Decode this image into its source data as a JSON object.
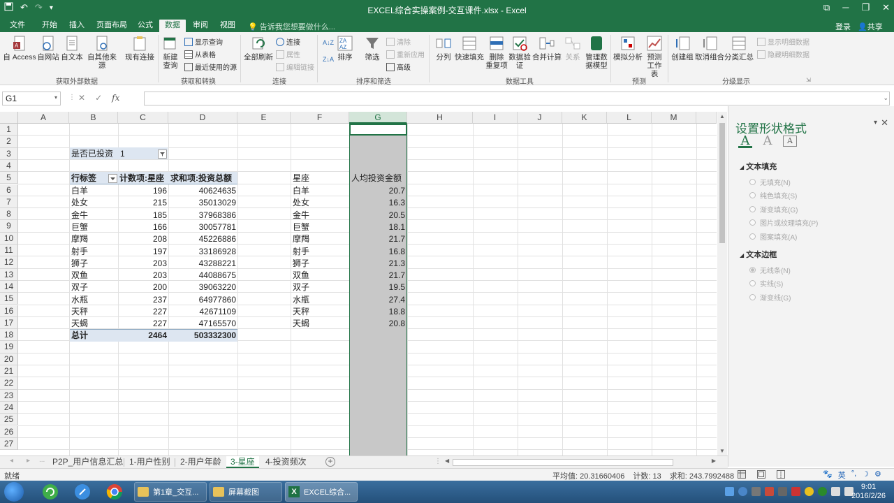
{
  "titlebar": {
    "title": "EXCEL综合实操案例-交互课件.xlsx - Excel",
    "undo": "↶",
    "redo": "↷",
    "qat_more": "▾",
    "win_restore": "⧉",
    "win_min": "─",
    "win_max": "❐",
    "win_close": "✕"
  },
  "tabs": {
    "items": [
      "文件",
      "开始",
      "插入",
      "页面布局",
      "公式",
      "数据",
      "审阅",
      "视图"
    ],
    "active": "数据",
    "tellme": "告诉我您想要做什么...",
    "login": "登录",
    "share": "共享"
  },
  "ribbon": {
    "groups": [
      "获取外部数据",
      "获取和转换",
      "连接",
      "排序和筛选",
      "数据工具",
      "预测",
      "分级显示"
    ],
    "get_external": [
      "自 Access",
      "自网站",
      "自文本",
      "自其他来源",
      "现有连接"
    ],
    "transform": {
      "new_query": "新建",
      "new_query2": "查询",
      "show_queries": "显示查询",
      "from_table": "从表格",
      "recent_sources": "最近使用的源"
    },
    "connections": {
      "refresh_all": "全部刷新",
      "connections": "连接",
      "properties": "属性",
      "edit_links": "编辑链接"
    },
    "sort_filter": {
      "sort": "排序",
      "filter": "筛选",
      "clear": "清除",
      "reapply": "重新应用",
      "advanced": "高级"
    },
    "data_tools": {
      "text_to_columns": "分列",
      "flash_fill": "快速填充",
      "remove_dup": "删除",
      "remove_dup2": "重复项",
      "validation": "数据验",
      "validation2": "证",
      "consolidate": "合并计算",
      "relationships": "关系",
      "manage_model": "管理数",
      "manage_model2": "据模型"
    },
    "forecast": {
      "whatif": "模拟分析",
      "forecast_sheet": "预测",
      "forecast_sheet2": "工作表"
    },
    "outline": {
      "group": "创建组",
      "ungroup": "取消组合",
      "subtotal": "分类汇总",
      "show_detail": "显示明细数据",
      "hide_detail": "隐藏明细数据"
    }
  },
  "formula_bar": {
    "name_box": "G1",
    "cancel": "✕",
    "enter": "✓",
    "fx": "fx",
    "value": ""
  },
  "columns": [
    "A",
    "B",
    "C",
    "D",
    "E",
    "F",
    "G",
    "H",
    "I",
    "J",
    "K",
    "L",
    "M"
  ],
  "selected_column": "G",
  "rows": [
    "1",
    "2",
    "3",
    "4",
    "5",
    "6",
    "7",
    "8",
    "9",
    "10",
    "11",
    "12",
    "13",
    "14",
    "15",
    "16",
    "17",
    "18",
    "19",
    "20",
    "21",
    "22",
    "23",
    "24",
    "25",
    "26",
    "27"
  ],
  "pivot": {
    "filter_label": "是否已投资",
    "filter_value": "1",
    "headers": [
      "行标签",
      "计数项:星座",
      "求和项:投资总额"
    ],
    "rows": [
      [
        "白羊",
        "196",
        "40624635"
      ],
      [
        "处女",
        "215",
        "35013029"
      ],
      [
        "金牛",
        "185",
        "37968386"
      ],
      [
        "巨蟹",
        "166",
        "30057781"
      ],
      [
        "摩羯",
        "208",
        "45226886"
      ],
      [
        "射手",
        "197",
        "33186928"
      ],
      [
        "狮子",
        "203",
        "43288221"
      ],
      [
        "双鱼",
        "203",
        "44088675"
      ],
      [
        "双子",
        "200",
        "39063220"
      ],
      [
        "水瓶",
        "237",
        "64977860"
      ],
      [
        "天秤",
        "227",
        "42671109"
      ],
      [
        "天蝎",
        "227",
        "47165570"
      ]
    ],
    "total": [
      "总计",
      "2464",
      "503332300"
    ]
  },
  "side_table": {
    "headers": [
      "星座",
      "人均投资金额"
    ],
    "rows": [
      [
        "白羊",
        "20.7"
      ],
      [
        "处女",
        "16.3"
      ],
      [
        "金牛",
        "20.5"
      ],
      [
        "巨蟹",
        "18.1"
      ],
      [
        "摩羯",
        "21.7"
      ],
      [
        "射手",
        "16.8"
      ],
      [
        "狮子",
        "21.3"
      ],
      [
        "双鱼",
        "21.7"
      ],
      [
        "双子",
        "19.5"
      ],
      [
        "水瓶",
        "27.4"
      ],
      [
        "天秤",
        "18.8"
      ],
      [
        "天蝎",
        "20.8"
      ]
    ]
  },
  "pane": {
    "title": "设置形状格式",
    "close": "✕",
    "dropdown": "▾",
    "section_fill": "文本填充",
    "fill_options": [
      "无填充(N)",
      "纯色填充(S)",
      "渐变填充(G)",
      "图片或纹理填充(P)",
      "图案填充(A)"
    ],
    "section_border": "文本边框",
    "border_options": [
      "无线条(N)",
      "实线(S)",
      "渐变线(G)"
    ]
  },
  "sheets": {
    "items": [
      "P2P_用户信息汇总",
      "1-用户性别",
      "2-用户年龄",
      "3-星座",
      "4-投资频次"
    ],
    "active": "3-星座",
    "nav_prev": "◂",
    "nav_next": "▸",
    "more": "...",
    "add": "+"
  },
  "status": {
    "ready": "就绪",
    "average": "平均值: 20.31660406",
    "count": "计数: 13",
    "sum": "求和: 243.7992488",
    "ime": "英"
  },
  "taskbar": {
    "items": [
      "第1章_交互...",
      "屏幕截图",
      "EXCEL综合..."
    ],
    "time": "9:01",
    "date": "2016/2/26"
  }
}
